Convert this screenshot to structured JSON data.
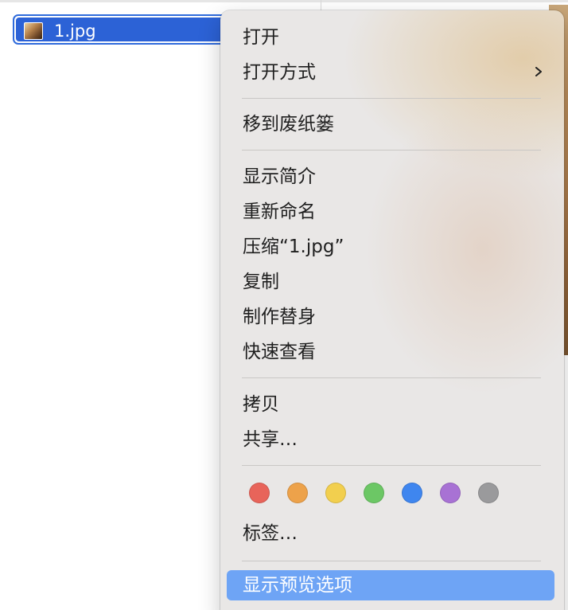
{
  "file": {
    "name": "1.jpg",
    "thumbnail_icon": "image-thumbnail-icon"
  },
  "menu": {
    "items": [
      {
        "id": "open",
        "label": "打开"
      },
      {
        "id": "open-with",
        "label": "打开方式",
        "submenu_icon": "chevron-right-icon"
      },
      {
        "id": "move-to-trash",
        "label": "移到废纸篓"
      },
      {
        "id": "get-info",
        "label": "显示简介"
      },
      {
        "id": "rename",
        "label": "重新命名"
      },
      {
        "id": "compress",
        "label": "压缩“1.jpg”"
      },
      {
        "id": "duplicate",
        "label": "复制"
      },
      {
        "id": "make-alias",
        "label": "制作替身"
      },
      {
        "id": "quick-look",
        "label": "快速查看"
      },
      {
        "id": "copy",
        "label": "拷贝"
      },
      {
        "id": "share",
        "label": "共享…"
      },
      {
        "id": "tags",
        "label": "标签…"
      },
      {
        "id": "show-preview-options",
        "label": "显示预览选项",
        "highlighted": true
      }
    ],
    "tag_colors": [
      {
        "name": "red",
        "color": "#e8645a"
      },
      {
        "name": "orange",
        "color": "#eda24a"
      },
      {
        "name": "yellow",
        "color": "#f2cf4e"
      },
      {
        "name": "green",
        "color": "#6cc765"
      },
      {
        "name": "blue",
        "color": "#3f86ef"
      },
      {
        "name": "purple",
        "color": "#a872d4"
      },
      {
        "name": "gray",
        "color": "#9a9a9c"
      }
    ],
    "highlight_color": "#6ea4f5",
    "selection_color": "#2c62d6"
  }
}
